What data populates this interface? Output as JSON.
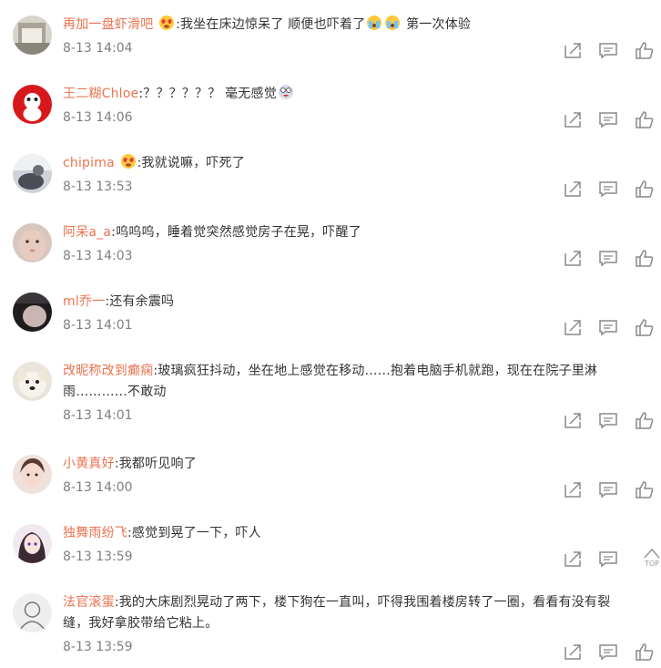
{
  "comments": [
    {
      "username": "再加一盘虾滑吧",
      "text_before_emoji": "",
      "text": ":我坐在床边惊呆了 顺便也吓着了",
      "text_after": " 第一次体验",
      "time": "8-13 14:04",
      "avatar_icon": "gray-photo-avatar",
      "emoji_lead": "heart-eyes-emoji",
      "emoji_trail": "crying-emoji"
    },
    {
      "username": "王二糊Chloe",
      "text": ":？？？？？？ 毫无感觉",
      "time": "8-13 14:06",
      "avatar_icon": "red-panda-avatar",
      "emoji_trail": "crazy-face-emoji"
    },
    {
      "username": "chipima",
      "text": ":我就说嘛，吓死了",
      "time": "8-13 13:53",
      "avatar_icon": "photo-avatar",
      "emoji_lead": "heart-eyes-emoji"
    },
    {
      "username": "阿呆a_a",
      "text": ":呜呜呜，睡着觉突然感觉房子在晃，吓醒了",
      "time": "8-13 14:03",
      "avatar_icon": "baby-photo-avatar"
    },
    {
      "username": "ml乔一",
      "text": ":还有余震吗",
      "time": "8-13 14:01",
      "avatar_icon": "dark-photo-avatar"
    },
    {
      "username": "改昵称改到癫痫",
      "text_line1": ":玻璃疯狂抖动，坐在地上感觉在移动……抱着电脑手机就跑，现在在院子里淋",
      "text_line2": "雨…………不敢动",
      "time": "8-13 14:01",
      "avatar_icon": "puppy-avatar"
    },
    {
      "username": "小黄真好",
      "text": ":我都听见响了",
      "time": "8-13 14:00",
      "avatar_icon": "girl-avatar"
    },
    {
      "username": "独舞雨纷飞",
      "text": ":感觉到晃了一下，吓人",
      "time": "8-13 13:59",
      "avatar_icon": "anime-girl-avatar"
    },
    {
      "username": "法官滚蛋",
      "text_line1": ":我的大床剧烈晃动了两下，楼下狗在一直叫，吓得我围着楼房转了一圈，看看有没有裂",
      "text_line2": "缝，我好拿胶带给它粘上。",
      "time": "8-13 13:59",
      "avatar_icon": "sketch-avatar"
    }
  ],
  "top_button_label": "TOP",
  "colors": {
    "username": "#eb7350",
    "text": "#333333",
    "time": "#808080",
    "icon": "#8a8a8a"
  }
}
